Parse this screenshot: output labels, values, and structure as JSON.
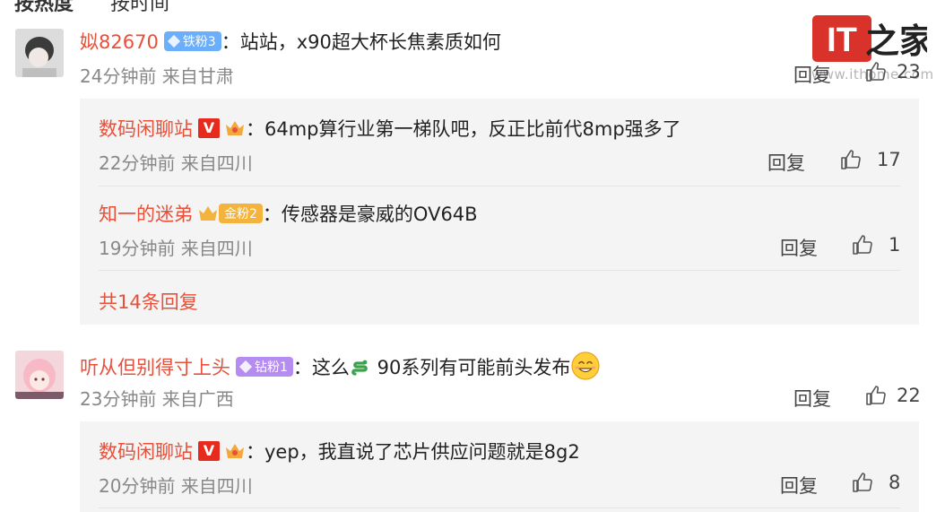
{
  "tabs": [
    "按热度",
    "按时间"
  ],
  "watermark": {
    "logo": "IT之家",
    "url": "www.ithome.com"
  },
  "colors": {
    "username": "#e8503a",
    "badge_iron": "#6aaefc",
    "badge_gold": "#f3b33c",
    "badge_diamond": "#b58cf0",
    "panel_bg": "#f4f4f4"
  },
  "comments": [
    {
      "user": "姒82670",
      "badge": "铁粉3",
      "text": "：站站，x90超大杯长焦素质如何",
      "meta": "24分钟前 来自甘肃",
      "reply_label": "回复",
      "likes": "23",
      "replies": [
        {
          "user": "数码闲聊站",
          "text": "：64mp算行业第一梯队吧，反正比前代8mp强多了",
          "meta": "22分钟前 来自四川",
          "reply_label": "回复",
          "likes": "17"
        },
        {
          "user": "知一的迷弟",
          "badge": "金粉2",
          "text": "：传感器是豪威的OV64B",
          "meta": "19分钟前 来自四川",
          "reply_label": "回复",
          "likes": "1"
        }
      ],
      "more_replies": "共14条回复"
    },
    {
      "user": "听从但别得寸上头",
      "badge": "钻粉1",
      "text_a": "：这么",
      "text_b": " 90系列有可能前头发布",
      "meta": "23分钟前 来自广西",
      "reply_label": "回复",
      "likes": "22",
      "replies": [
        {
          "user": "数码闲聊站",
          "text": "：yep，我直说了芯片供应问题就是8g2",
          "meta": "20分钟前 来自四川",
          "reply_label": "回复",
          "likes": "8"
        }
      ]
    }
  ]
}
